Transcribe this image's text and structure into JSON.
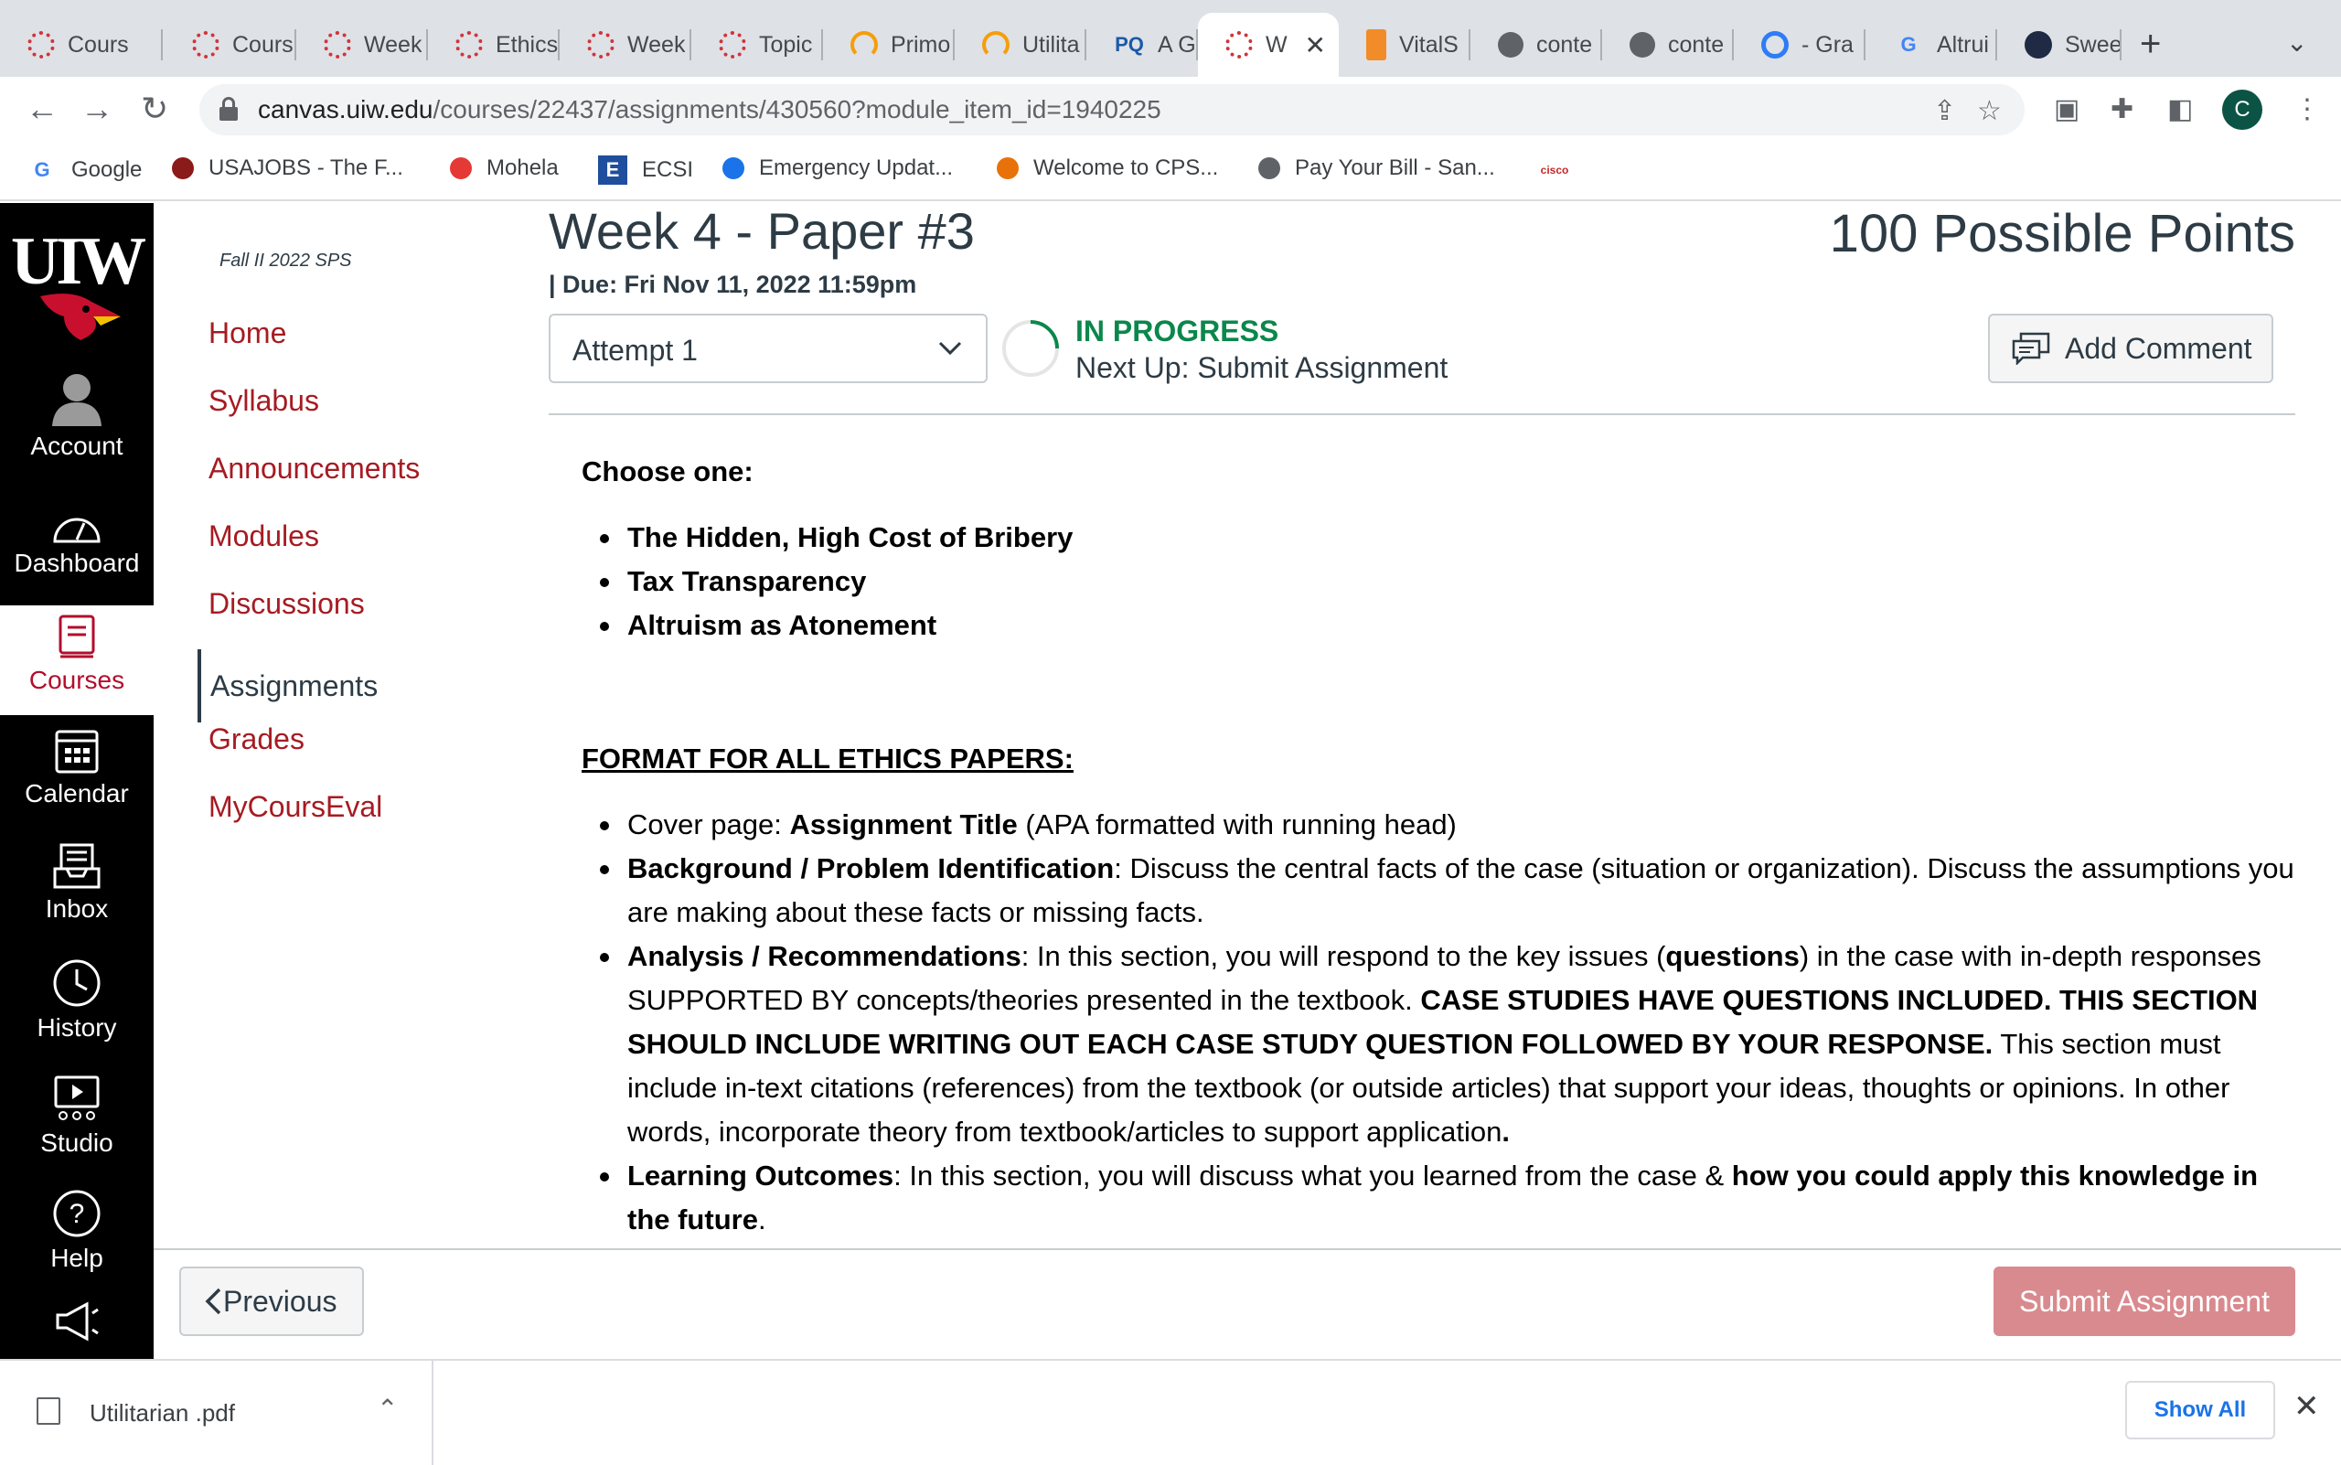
{
  "browser": {
    "tabs": [
      {
        "title": "Cours",
        "icon": "canvas-icon"
      },
      {
        "title": "Cours",
        "icon": "canvas-icon"
      },
      {
        "title": "Week",
        "icon": "canvas-icon"
      },
      {
        "title": "Ethics",
        "icon": "canvas-icon"
      },
      {
        "title": "Week",
        "icon": "canvas-icon"
      },
      {
        "title": "Topic",
        "icon": "canvas-icon"
      },
      {
        "title": "Primo",
        "icon": "primo-icon"
      },
      {
        "title": "Utilita",
        "icon": "primo-icon"
      },
      {
        "title": "A Gro",
        "icon": "pq-icon",
        "glyph": "PQ"
      },
      {
        "title": "W",
        "icon": "canvas-icon",
        "active": true
      },
      {
        "title": "VitalS",
        "icon": "vitalsource-icon"
      },
      {
        "title": "conte",
        "icon": "globe-icon"
      },
      {
        "title": "conte",
        "icon": "globe-icon"
      },
      {
        "title": "- Gra",
        "icon": "grammarly-icon"
      },
      {
        "title": "Altrui",
        "icon": "google-icon",
        "glyph": "G"
      },
      {
        "title": "Swee",
        "icon": "badge-icon"
      }
    ],
    "url_host": "canvas.uiw.edu",
    "url_path": "/courses/22437/assignments/430560?module_item_id=1940225",
    "profile_initial": "C",
    "bookmarks": [
      {
        "label": "Google",
        "icon": "google-icon",
        "glyph": "G"
      },
      {
        "label": "USAJOBS - The F...",
        "icon": "usajobs-icon"
      },
      {
        "label": "Mohela",
        "icon": "mohela-icon"
      },
      {
        "label": "ECSI",
        "icon": "ecsi-icon",
        "glyph": "E"
      },
      {
        "label": "Emergency Updat...",
        "icon": "snowflake-icon"
      },
      {
        "label": "Welcome to CPS...",
        "icon": "cps-icon"
      },
      {
        "label": "Pay Your Bill - San...",
        "icon": "bill-icon"
      },
      {
        "label": "",
        "icon": "cisco-icon",
        "glyph": "cisco"
      }
    ]
  },
  "global_nav": {
    "logo_text": "UIW",
    "items": [
      {
        "label": "Account",
        "icon": "account-icon"
      },
      {
        "label": "Dashboard",
        "icon": "dashboard-icon"
      },
      {
        "label": "Courses",
        "icon": "courses-icon",
        "active": true
      },
      {
        "label": "Calendar",
        "icon": "calendar-icon"
      },
      {
        "label": "Inbox",
        "icon": "inbox-icon"
      },
      {
        "label": "History",
        "icon": "history-icon"
      },
      {
        "label": "Studio",
        "icon": "studio-icon"
      },
      {
        "label": "Help",
        "icon": "help-icon"
      }
    ]
  },
  "course_nav": {
    "term": "Fall II 2022 SPS",
    "items": [
      "Home",
      "Syllabus",
      "Announcements",
      "Modules",
      "Discussions",
      "Assignments",
      "Grades",
      "MyCoursEval"
    ],
    "active": "Assignments"
  },
  "assignment": {
    "title": "Week 4 - Paper #3",
    "due": "| Due: Fri Nov 11, 2022 11:59pm",
    "points": "100 Possible Points",
    "attempt": "Attempt 1",
    "status": "IN PROGRESS",
    "next_up": "Next Up: Submit Assignment",
    "add_comment": "Add Comment"
  },
  "content": {
    "choose_heading": "Choose one:",
    "choices": [
      "The Hidden, High Cost of Bribery",
      "Tax Transparency",
      "Altruism as Atonement"
    ],
    "format_heading": "FORMAT FOR ALL ETHICS PAPERS:",
    "format_items": [
      {
        "parts": [
          {
            "t": "Cover page: "
          },
          {
            "t": "Assignment Title",
            "b": true
          },
          {
            "t": " (APA formatted with running head)"
          }
        ]
      },
      {
        "parts": [
          {
            "t": "Background / Problem Identification",
            "b": true
          },
          {
            "t": ": Discuss the central facts of the case (situation or organization). Discuss the assumptions you are making about these facts or missing facts."
          }
        ]
      },
      {
        "parts": [
          {
            "t": "Analysis / Recommendations",
            "b": true
          },
          {
            "t": ": In this section, you will respond to the key issues ("
          },
          {
            "t": "questions",
            "b": true
          },
          {
            "t": ") in the case with in-depth responses SUPPORTED BY concepts/theories presented in the textbook. "
          },
          {
            "t": "CASE STUDIES HAVE QUESTIONS INCLUDED.  THIS SECTION SHOULD INCLUDE WRITING OUT EACH CASE STUDY QUESTION FOLLOWED BY YOUR RESPONSE.",
            "b": true
          },
          {
            "t": " This section must include in-text citations (references) from the textbook (or outside articles) that support your ideas, thoughts or opinions. In other words, incorporate theory from textbook/articles to support application"
          },
          {
            "t": ".",
            "b": true
          }
        ]
      },
      {
        "parts": [
          {
            "t": "Learning Outcomes",
            "b": true
          },
          {
            "t": ": In this section, you will discuss what you learned from the case & "
          },
          {
            "t": "how you could apply this knowledge in the future",
            "b": true
          },
          {
            "t": "."
          }
        ]
      }
    ]
  },
  "footer": {
    "previous": "Previous",
    "submit": "Submit Assignment"
  },
  "downloads": {
    "file": "Utilitarian .pdf",
    "show_all": "Show All"
  },
  "colors": {
    "canvas_red": "#a61b22",
    "status_green": "#0b874b",
    "submit_disabled": "#d98a8e",
    "nav_black": "#000000"
  }
}
